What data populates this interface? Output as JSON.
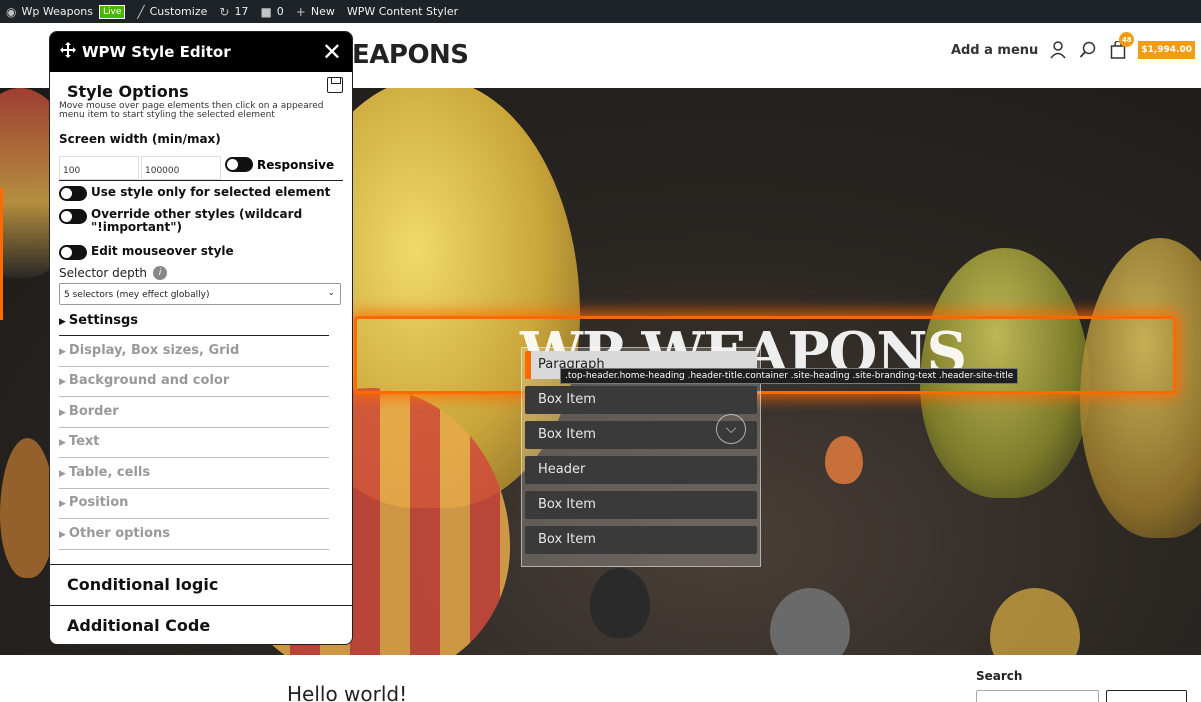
{
  "admin_bar": {
    "site_name": "Wp Weapons",
    "live_badge": "Live",
    "customize": "Customize",
    "updates_count": "17",
    "comments_count": "0",
    "new_label": "New",
    "plugin_label": "WPW Content Styler"
  },
  "header": {
    "site_title_partial": "EAPONS",
    "menu_link": "Add a menu",
    "cart_count": "48",
    "cart_total": "$1,994.00"
  },
  "hero": {
    "title": "WP WEAPONS"
  },
  "context_menu": {
    "tooltip": ".top-header.home-heading .header-title.container .site-heading .site-branding-text .header-site-title",
    "items": [
      "Paragraph",
      "Box Item",
      "Box Item",
      "Header",
      "Box Item",
      "Box Item"
    ]
  },
  "editor": {
    "title": "WPW Style Editor",
    "section_title": "Style Options",
    "instructions": "Move mouse over page elements then click on a appeared menu item to start styling the selected element",
    "screen_width_label": "Screen width (min/max)",
    "min_width": "100",
    "max_width": "100000",
    "responsive_label": "Responsive",
    "toggle_selected": "Use style only for selected element",
    "toggle_override": "Override other styles (wildcard \"!important\")",
    "toggle_mouseover": "Edit mouseover style",
    "selector_depth_label": "Selector depth",
    "selector_depth_value": "5 selectors (mey effect globally)",
    "settings_label": "Settinsgs",
    "accordion": [
      "Display, Box sizes, Grid",
      "Background and color",
      "Border",
      "Text",
      "Table, cells",
      "Position",
      "Other options"
    ],
    "conditional_logic": "Conditional logic",
    "additional_code": "Additional Code"
  },
  "content": {
    "post_title": "Hello world!",
    "search_label": "Search"
  },
  "colors": {
    "accent": "#ff6a00",
    "admin_bar": "#1d2327",
    "cart_badge": "#f39c12"
  }
}
